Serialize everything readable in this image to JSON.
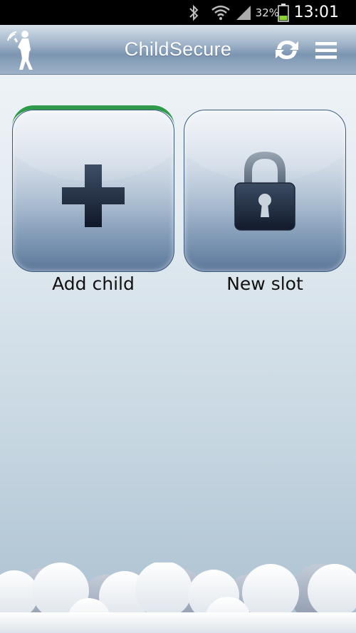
{
  "status_bar": {
    "battery_percent": "32%",
    "time": "13:01",
    "icons": [
      "bluetooth-icon",
      "wifi-icon",
      "signal-icon",
      "battery-icon"
    ]
  },
  "app_bar": {
    "title": "ChildSecure",
    "logo": "walking-child-signal-icon",
    "actions": [
      "sync-icon",
      "menu-icon"
    ]
  },
  "tiles": [
    {
      "label": "Add child",
      "icon": "plus-icon",
      "selected": true
    },
    {
      "label": "New slot",
      "icon": "lock-icon",
      "selected": false
    }
  ],
  "colors": {
    "accent_selected": "#2e9a4a",
    "app_bar": "#8aa1bb",
    "tile_border": "#3c5a80"
  }
}
